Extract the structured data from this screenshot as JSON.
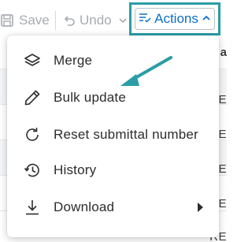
{
  "toolbar": {
    "save_label": "Save",
    "undo_label": "Undo",
    "actions_label": "Actions"
  },
  "menu": {
    "items": [
      {
        "label": "Merge",
        "icon": "layers-icon"
      },
      {
        "label": "Bulk update",
        "icon": "pencil-icon"
      },
      {
        "label": "Reset submittal number",
        "icon": "reset-icon"
      },
      {
        "label": "History",
        "icon": "history-icon"
      },
      {
        "label": "Download",
        "icon": "download-icon",
        "has_submenu": true
      }
    ]
  },
  "background": {
    "header_fragment": "a",
    "cell_fragments": [
      "RE",
      "RE",
      "RE",
      "RE",
      "RE"
    ]
  },
  "colors": {
    "accent_blue": "#0f6fc6",
    "annotation_teal": "#2a9da6",
    "disabled_gray": "#a7abb0",
    "menu_text": "#2c2c2c"
  }
}
